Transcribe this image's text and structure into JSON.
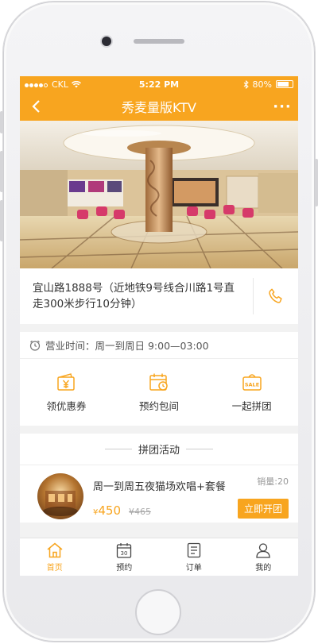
{
  "status_bar": {
    "carrier": "CKL",
    "time": "5:22 PM",
    "battery": "80%"
  },
  "nav": {
    "title": "秀麦量版KTV"
  },
  "venue": {
    "address": "宜山路1888号（近地铁9号线合川路1号直走300米步行10分钟）",
    "hours": "营业时间：周一到周日  9:00—03:00"
  },
  "actions": [
    {
      "label": "领优惠券",
      "icon": "coupon-icon"
    },
    {
      "label": "预约包间",
      "icon": "calendar-clock-icon"
    },
    {
      "label": "一起拼团",
      "icon": "sale-bag-icon"
    }
  ],
  "group_section": {
    "title": "拼团活动"
  },
  "deal": {
    "name": "周一到周五夜猫场欢唱+套餐",
    "sales": "销量:20",
    "price": "450",
    "currency": "¥",
    "original_price": "¥465",
    "button": "立即开团"
  },
  "tabs": [
    {
      "label": "首页",
      "icon": "home-icon",
      "active": true
    },
    {
      "label": "预约",
      "icon": "calendar-30-icon"
    },
    {
      "label": "订单",
      "icon": "order-list-icon"
    },
    {
      "label": "我的",
      "icon": "user-icon"
    }
  ],
  "colors": {
    "accent": "#f8a51f",
    "background": "#f2f2f2"
  }
}
